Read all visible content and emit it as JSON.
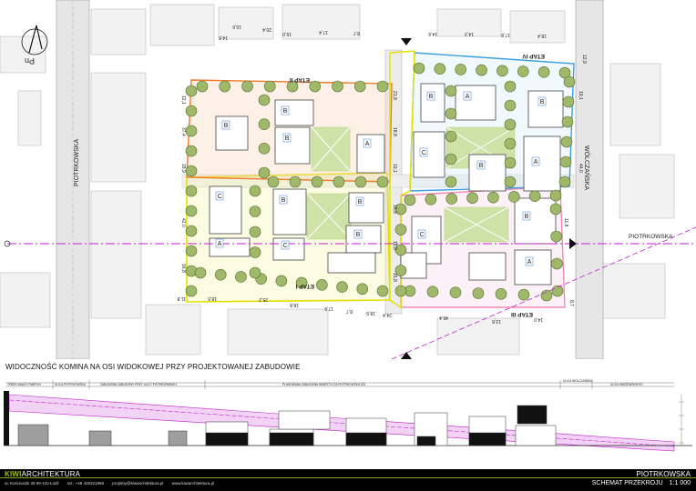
{
  "plan": {
    "phase_labels": [
      "ETAP II",
      "ETAP IV",
      "ETAP I",
      "ETAP III"
    ],
    "street_labels": [
      "PIOTRKOWSKA",
      "WÓLCZAŃSKA"
    ],
    "street_labels_right": "PIOTRKOWSKA",
    "north_label": "Pn",
    "building_tags": [
      "B",
      "B",
      "B",
      "A",
      "C",
      "B",
      "B",
      "B",
      "A",
      "C",
      "B",
      "A",
      "B",
      "C",
      "B",
      "A",
      "C",
      "B",
      "A"
    ],
    "dimensions": [
      "10,6",
      "20,4",
      "17,4",
      "8,7",
      "17,8",
      "18,4",
      "14,6",
      "15,0",
      "14,6",
      "14,3",
      "12,1",
      "37,4",
      "18,9",
      "42,0",
      "16,8",
      "11,8",
      "18,5",
      "25,2",
      "18,8",
      "17,6",
      "8,7",
      "18,5",
      "24,4",
      "46,4",
      "13,8",
      "14,0",
      "8,7",
      "11,8",
      "21,8",
      "18,8",
      "19,1",
      "18,9",
      "18,8",
      "15,8",
      "19,1",
      "44,0",
      "12,9"
    ]
  },
  "section": {
    "title": "WIDOCZNOŚĆ KOMINA NA OSI WIDOKOWEJ PRZY PROJEKTOWANEJ ZABUDOWIE",
    "labels": [
      "TEREN BIAŁEJ FABRYKI",
      "ULICA PIOTRKOWSKA",
      "ZABUDOWA ZABUDOWY PRZY ULICY PIOTRKOWSKIEJ",
      "PLANOWANA ZABUDOWA INWESTYCJA PIOTRKOWSKA 225",
      "ULICA WÓLCZAŃSKA",
      "ULICA WIDZEWSKIEGO"
    ]
  },
  "footer": {
    "brand_kiwi": "KIWI",
    "brand_rest": "ARCHITEKTURA",
    "address": "ul. Kościuszki 28 90-410 Łódź",
    "phone": "tel.: +48 426321959",
    "email": "projekty@kiwiarchitektura.pl",
    "web": "www.kiwiarchitektura.pl",
    "project": "PIOTRKOWSKA",
    "sheet": "SCHEMAT PRZEKROJU",
    "scale": "1:1 000"
  },
  "colors": {
    "etap1": "#e3e000",
    "etap2": "#f07a2a",
    "etap3": "#f08ab6",
    "etap4": "#3aa0e0",
    "axis": "#c21fd0",
    "tree": "#9fb86a",
    "green": "#cfe2a8",
    "brand": "#9bc41a"
  }
}
